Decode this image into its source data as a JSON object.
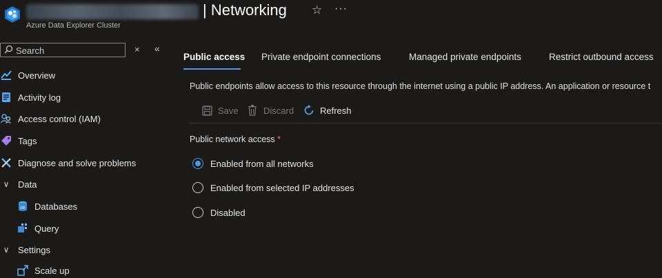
{
  "header": {
    "title": "| Networking",
    "subtitle": "Azure Data Explorer Cluster",
    "star_glyph": "☆",
    "more_glyph": "···"
  },
  "sidebar": {
    "search_placeholder": "Search",
    "clear_glyph": "×",
    "collapse_glyph": "«",
    "items": [
      {
        "label": "Overview",
        "icon": "overview-icon"
      },
      {
        "label": "Activity log",
        "icon": "activity-log-icon"
      },
      {
        "label": "Access control (IAM)",
        "icon": "iam-icon"
      },
      {
        "label": "Tags",
        "icon": "tag-icon"
      },
      {
        "label": "Diagnose and solve problems",
        "icon": "diagnose-icon"
      },
      {
        "label": "Data",
        "icon": "chevron-down-icon"
      },
      {
        "label": "Databases",
        "icon": "database-icon"
      },
      {
        "label": "Query",
        "icon": "query-icon"
      },
      {
        "label": "Settings",
        "icon": "chevron-down-icon"
      },
      {
        "label": "Scale up",
        "icon": "scale-up-icon"
      }
    ]
  },
  "tabs": [
    {
      "label": "Public access",
      "active": true
    },
    {
      "label": "Private endpoint connections",
      "active": false
    },
    {
      "label": "Managed private endpoints",
      "active": false
    },
    {
      "label": "Restrict outbound access",
      "active": false
    }
  ],
  "description": "Public endpoints allow access to this resource through the internet using a public IP address. An application or resource t",
  "toolbar": {
    "save": "Save",
    "discard": "Discard",
    "refresh": "Refresh"
  },
  "network_access": {
    "label": "Public network access",
    "required_mark": "*",
    "options": [
      {
        "label": "Enabled from all networks",
        "selected": true
      },
      {
        "label": "Enabled from selected IP addresses",
        "selected": false
      },
      {
        "label": "Disabled",
        "selected": false
      }
    ]
  },
  "colors": {
    "accent": "#4f9ae8",
    "background": "#1b1a19",
    "required": "#f1707b"
  }
}
